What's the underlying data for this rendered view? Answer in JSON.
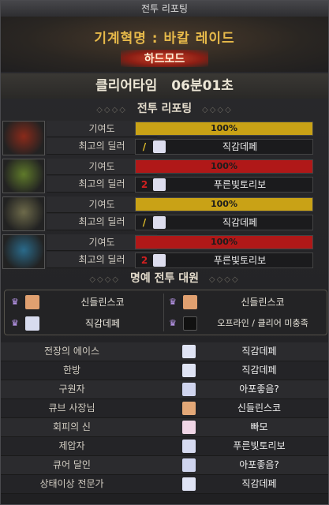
{
  "window": {
    "title": "전투 리포팅"
  },
  "raid": {
    "name": "기계혁명 : 바칼 레이드",
    "difficulty": "하드모드"
  },
  "clear": {
    "label": "클리어타임",
    "time": "06분01초"
  },
  "sections": {
    "battle_report": "전투 리포팅",
    "honor": "명예 전투 대원"
  },
  "labels": {
    "contribution": "기여도",
    "top_dealer": "최고의 딜러"
  },
  "parties": [
    {
      "contribution_text": "100%",
      "contribution": 1.0,
      "bar_color": "#c9a216",
      "class_icon": "slash-icon",
      "class_color": "#e5c22a",
      "dealer": "직감데페",
      "portrait_color": "#8a2a1a"
    },
    {
      "contribution_text": "100%",
      "contribution": 1.0,
      "bar_color": "#b01818",
      "class_icon": "number-2-icon",
      "class_color": "#d02020",
      "dealer": "푸른빛토리보",
      "portrait_color": "#5f7a2a"
    },
    {
      "contribution_text": "100%",
      "contribution": 1.0,
      "bar_color": "#c9a216",
      "class_icon": "slash-icon",
      "class_color": "#e5c22a",
      "dealer": "직감데페",
      "portrait_color": "#6d6a4a"
    },
    {
      "contribution_text": "100%",
      "contribution": 1.0,
      "bar_color": "#b01818",
      "class_icon": "number-2-icon",
      "class_color": "#d02020",
      "dealer": "푸른빛토리보",
      "portrait_color": "#2a6a8a"
    }
  ],
  "honor_members": [
    {
      "name": "신들린스코",
      "avatar_color": "#e0a070"
    },
    {
      "name": "신들린스코",
      "avatar_color": "#e0a070"
    },
    {
      "name": "직감데페",
      "avatar_color": "#d8dcef"
    },
    {
      "name": "오프라인 / 클리어 미충족",
      "avatar_color": "#111111"
    }
  ],
  "titles": [
    {
      "label": "전장의 에이스",
      "player": "직감데페",
      "avatar_color": "#dfe3f4"
    },
    {
      "label": "한방",
      "player": "직감데페",
      "avatar_color": "#dfe3f4"
    },
    {
      "label": "구원자",
      "player": "아포좋음?",
      "avatar_color": "#cfd4ee"
    },
    {
      "label": "큐브 사장님",
      "player": "신들린스코",
      "avatar_color": "#e3a878"
    },
    {
      "label": "회피의 신",
      "player": "빠모",
      "avatar_color": "#f0d6e6"
    },
    {
      "label": "제압자",
      "player": "푸른빛토리보",
      "avatar_color": "#d6daf0"
    },
    {
      "label": "큐어 달인",
      "player": "아포좋음?",
      "avatar_color": "#cfd4ee"
    },
    {
      "label": "상태이상 전문가",
      "player": "직감데페",
      "avatar_color": "#dfe3f4"
    }
  ]
}
